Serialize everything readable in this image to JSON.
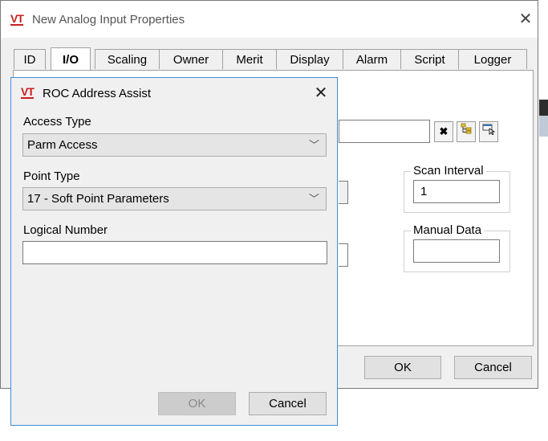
{
  "main_window": {
    "title": "New Analog Input Properties",
    "tabs": [
      "ID",
      "I/O",
      "Scaling",
      "Owner",
      "Merit",
      "Display",
      "Alarm",
      "Script",
      "Logger"
    ],
    "active_tab": "I/O",
    "address_buttons": {
      "clear_icon": "x-icon",
      "tree_icon": "tree-browse-icon",
      "pick_icon": "pick-point-icon"
    },
    "scan_interval": {
      "label": "Scan Interval",
      "value": "1"
    },
    "manual_data": {
      "label": "Manual Data",
      "value": ""
    },
    "ok_label": "OK",
    "cancel_label": "Cancel"
  },
  "dialog": {
    "title": "ROC Address Assist",
    "access_type": {
      "label": "Access Type",
      "value": "Parm Access"
    },
    "point_type": {
      "label": "Point Type",
      "value": "17 - Soft Point Parameters"
    },
    "logical_number": {
      "label": "Logical Number",
      "value": ""
    },
    "ok_label": "OK",
    "cancel_label": "Cancel"
  },
  "branding": {
    "logo_text": "VT",
    "logo_color": "#cc1f1f",
    "accent": "#3c8ed8"
  }
}
